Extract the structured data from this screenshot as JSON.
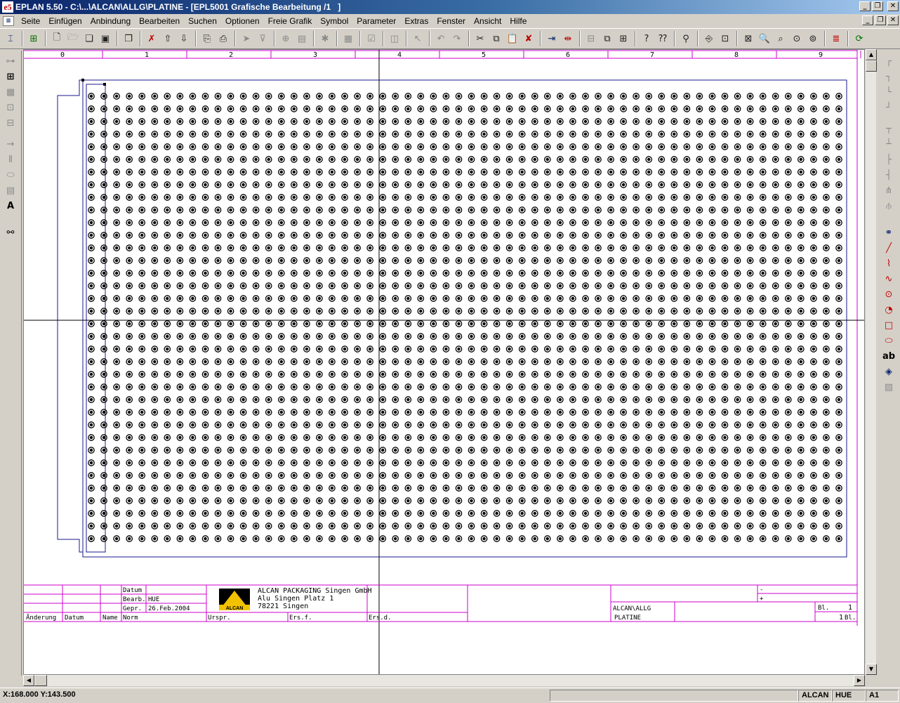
{
  "window": {
    "title": "EPLAN 5.50 - C:\\...\\ALCAN\\ALLG\\PLATINE - [EPL5001 Grafische Bearbeitung /1   ]",
    "app_icon": "e5",
    "controls": {
      "minimize": "_",
      "restore": "❐",
      "close": "✕"
    }
  },
  "menu": {
    "items": [
      "Seite",
      "Einfügen",
      "Anbindung",
      "Bearbeiten",
      "Suchen",
      "Optionen",
      "Freie Grafik",
      "Symbol",
      "Parameter",
      "Extras",
      "Fenster",
      "Ansicht",
      "Hilfe"
    ]
  },
  "drawing": {
    "column_labels": [
      "0",
      "1",
      "2",
      "3",
      "4",
      "5",
      "6",
      "7",
      "8",
      "9"
    ],
    "grid": {
      "columns": 60,
      "rows": 36
    },
    "frame_color": "#cc00cc",
    "shape_color": "#1a1a8c"
  },
  "titleblock": {
    "datum_label": "Datum",
    "bearb_label": "Bearb.",
    "bearb_value": "HUE",
    "gepr_label": "Gepr.",
    "gepr_value": "26.Feb.2004",
    "change_headers": [
      "Änderung",
      "Datum",
      "Name",
      "Norm"
    ],
    "urspr": "Urspr.",
    "ersf": "Ers.f.",
    "ersd": "Ers.d.",
    "logo_text": "ALCAN",
    "company_line1": "ALCAN PACKAGING Singen GmbH",
    "company_line2": "Alu Singen Platz 1",
    "company_line3": "78221 Singen",
    "minus": "-",
    "plus": "+",
    "project_line1": "ALCAN\\ALLG",
    "project_line2": "PLATINE",
    "sheet_label": "Bl.",
    "sheet_value": "1",
    "sheets_total": "1",
    "sheets_label": "Bl."
  },
  "statusbar": {
    "coords": "X:168.000 Y:143.500",
    "company": "ALCAN",
    "user": "HUE",
    "sheet_size": "A1"
  }
}
